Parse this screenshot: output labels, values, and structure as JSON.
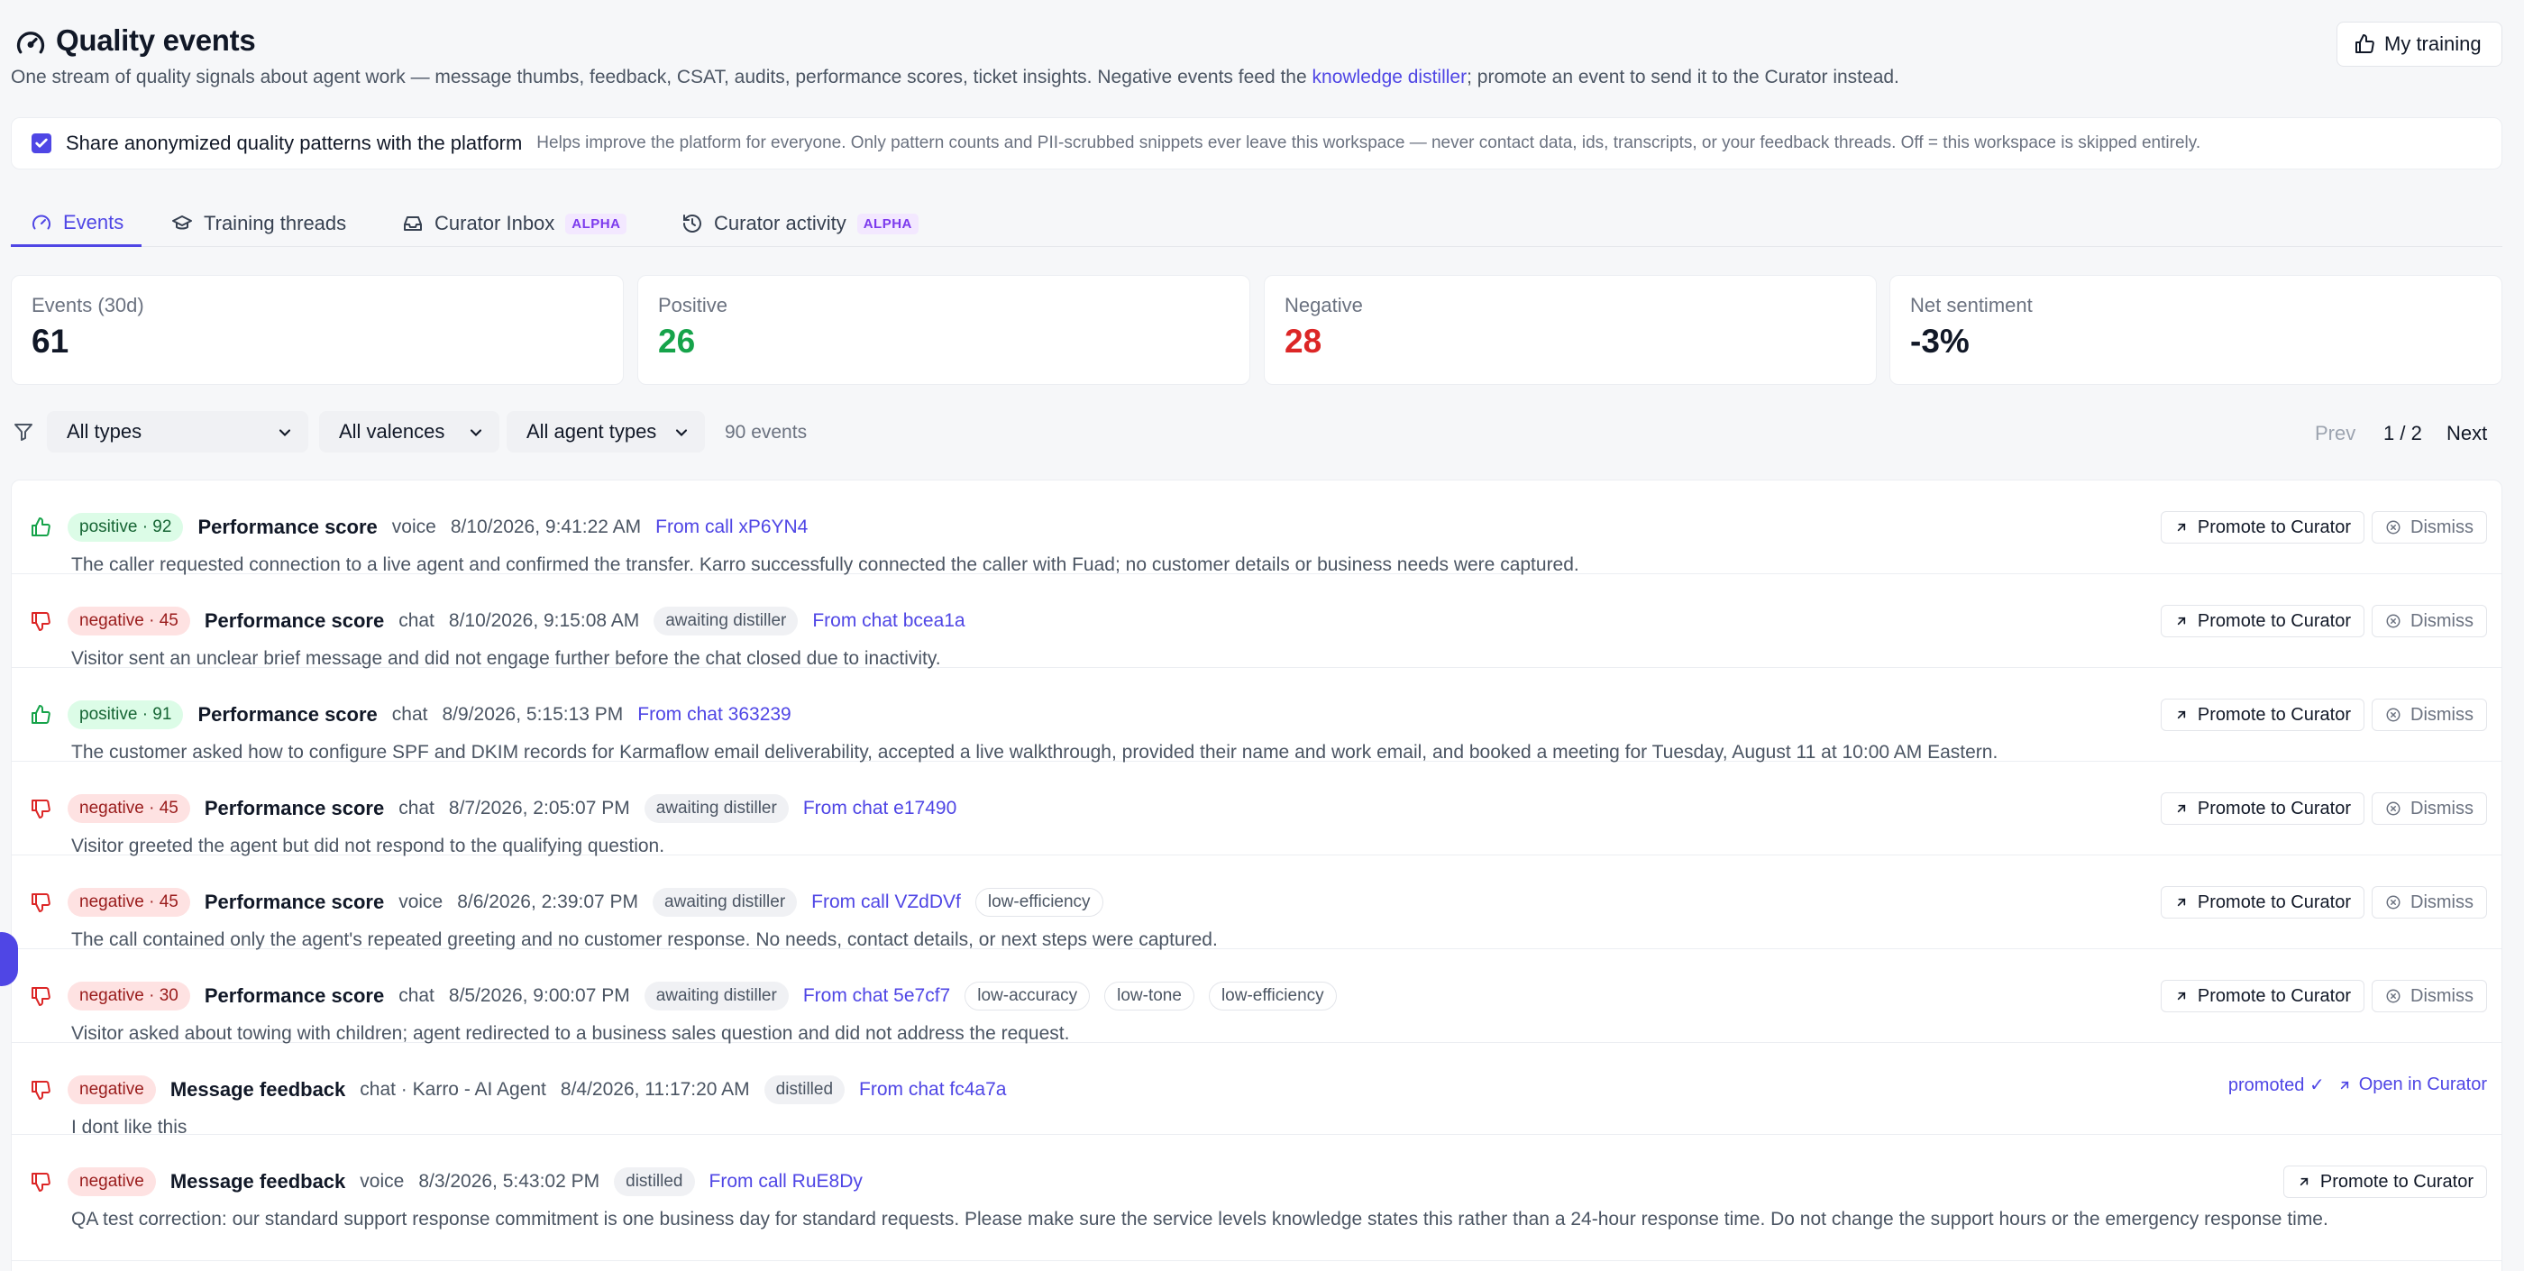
{
  "header": {
    "title": "Quality events",
    "description_before": "One stream of quality signals about agent work — message thumbs, feedback, CSAT, audits, performance scores, ticket insights. Negative events feed the ",
    "description_link": "knowledge distiller",
    "description_after": "; promote an event to send it to the Curator instead.",
    "my_training": "My training"
  },
  "share": {
    "checked": true,
    "label": "Share anonymized quality patterns with the platform",
    "help": "Helps improve the platform for everyone. Only pattern counts and PII-scrubbed snippets ever leave this workspace — never contact data, ids, transcripts, or your feedback threads. Off = this workspace is skipped entirely."
  },
  "tabs": [
    {
      "label": "Events",
      "active": true,
      "badge": ""
    },
    {
      "label": "Training threads",
      "active": false,
      "badge": ""
    },
    {
      "label": "Curator Inbox",
      "active": false,
      "badge": "ALPHA"
    },
    {
      "label": "Curator activity",
      "active": false,
      "badge": "ALPHA"
    }
  ],
  "stats": [
    {
      "label": "Events (30d)",
      "value": "61"
    },
    {
      "label": "Positive",
      "value": "26"
    },
    {
      "label": "Negative",
      "value": "28"
    },
    {
      "label": "Net sentiment",
      "value": "-3%"
    }
  ],
  "filters": {
    "type": "All types",
    "valence": "All valences",
    "agent_type": "All agent types",
    "count": "90 events",
    "prev": "Prev",
    "page": "1 / 2",
    "next": "Next"
  },
  "actions": {
    "promote": "Promote to Curator",
    "dismiss": "Dismiss",
    "promoted": "promoted ✓",
    "open": "Open in Curator"
  },
  "events": [
    {
      "valence": "positive · 92",
      "kind": "Performance score",
      "channel": "voice",
      "time": "8/10/2026, 9:41:22 AM",
      "status": "",
      "source": "From call xP6YN4",
      "tags": [],
      "summary": "The caller requested connection to a live agent and confirmed the transfer. Karro successfully connected the caller with Fuad; no customer details or business needs were captured."
    },
    {
      "valence": "negative · 45",
      "kind": "Performance score",
      "channel": "chat",
      "time": "8/10/2026, 9:15:08 AM",
      "status": "awaiting distiller",
      "source": "From chat bcea1a",
      "tags": [],
      "summary": "Visitor sent an unclear brief message and did not engage further before the chat closed due to inactivity."
    },
    {
      "valence": "positive · 91",
      "kind": "Performance score",
      "channel": "chat",
      "time": "8/9/2026, 5:15:13 PM",
      "status": "",
      "source": "From chat 363239",
      "tags": [],
      "summary": "The customer asked how to configure SPF and DKIM records for Karmaflow email deliverability, accepted a live walkthrough, provided their name and work email, and booked a meeting for Tuesday, August 11 at 10:00 AM Eastern."
    },
    {
      "valence": "negative · 45",
      "kind": "Performance score",
      "channel": "chat",
      "time": "8/7/2026, 2:05:07 PM",
      "status": "awaiting distiller",
      "source": "From chat e17490",
      "tags": [],
      "summary": "Visitor greeted the agent but did not respond to the qualifying question."
    },
    {
      "valence": "negative · 45",
      "kind": "Performance score",
      "channel": "voice",
      "time": "8/6/2026, 2:39:07 PM",
      "status": "awaiting distiller",
      "source": "From call VZdDVf",
      "tags": [
        "low-efficiency"
      ],
      "summary": "The call contained only the agent's repeated greeting and no customer response. No needs, contact details, or next steps were captured."
    },
    {
      "valence": "negative · 30",
      "kind": "Performance score",
      "channel": "chat",
      "time": "8/5/2026, 9:00:07 PM",
      "status": "awaiting distiller",
      "source": "From chat 5e7cf7",
      "tags": [
        "low-accuracy",
        "low-tone",
        "low-efficiency"
      ],
      "summary": "Visitor asked about towing with children; agent redirected to a business sales question and did not address the request."
    },
    {
      "valence": "negative",
      "kind": "Message feedback",
      "channel": "chat · Karro - AI Agent",
      "time": "8/4/2026, 11:17:20 AM",
      "status": "distilled",
      "source": "From chat fc4a7a",
      "tags": [],
      "summary": "I dont like this"
    },
    {
      "valence": "negative",
      "kind": "Message feedback",
      "channel": "voice",
      "time": "8/3/2026, 5:43:02 PM",
      "status": "distilled",
      "source": "From call RuE8Dy",
      "tags": [],
      "summary": "QA test correction: our standard support response commitment is one business day for standard requests. Please make sure the service levels knowledge states this rather than a 24-hour response time. Do not change the support hours or the emergency response time."
    }
  ],
  "colors": {
    "accent": "#4f46e5",
    "positive": "#16a34a",
    "negative": "#dc2626"
  }
}
